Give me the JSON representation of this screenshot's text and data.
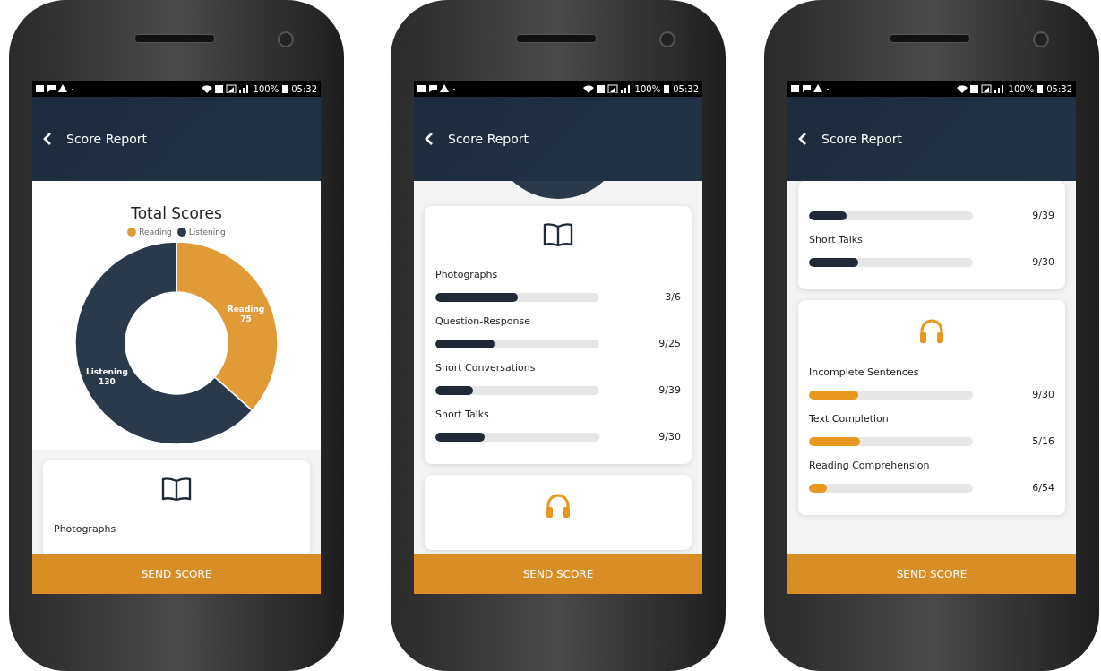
{
  "phones": [
    {
      "status_bar": {
        "battery": "100%",
        "time": "05:32"
      },
      "header": {
        "title": "Score Report"
      },
      "sections": [
        {
          "kind": "chart",
          "legend": [
            {
              "label": "Reading",
              "color": "#e09b36"
            },
            {
              "label": "Listening",
              "color": "#2b3a4b"
            }
          ],
          "chart_data": {
            "type": "donut",
            "title": "Total Scores",
            "categories": [
              "Reading",
              "Listening"
            ],
            "values": [
              75,
              130
            ],
            "data_labels": true
          }
        },
        {
          "kind": "reading_card",
          "items": [
            {
              "label": "Photographs"
            }
          ]
        }
      ],
      "button": "SEND SCORE"
    },
    {
      "status_bar": {
        "battery": "100%",
        "time": "05:32"
      },
      "header": {
        "title": "Score Report"
      },
      "sections": [
        {
          "kind": "chart_edge"
        },
        {
          "kind": "reading_card",
          "items": [
            {
              "label": "Photographs",
              "level": 0.5,
              "score": "3/6"
            },
            {
              "label": "Question-Response",
              "level": 0.36,
              "score": "9/25"
            },
            {
              "label": "Short Conversations",
              "level": 0.23,
              "score": "9/39"
            },
            {
              "label": "Short Talks",
              "level": 0.3,
              "score": "9/30"
            }
          ]
        },
        {
          "kind": "listening_card"
        }
      ],
      "button": "SEND SCORE"
    },
    {
      "status_bar": {
        "battery": "100%",
        "time": "05:32"
      },
      "header": {
        "title": "Score Report"
      },
      "sections": [
        {
          "kind": "card",
          "items": [
            {
              "level": 0.23,
              "score": "9/39"
            },
            {
              "label": "Short Talks",
              "level": 0.3,
              "score": "9/30"
            }
          ]
        },
        {
          "kind": "listening_card",
          "items": [
            {
              "label": "Incomplete Sentences",
              "level": 0.3,
              "score": "9/30"
            },
            {
              "label": "Text Completion",
              "level": 0.31,
              "score": "5/16"
            },
            {
              "label": "Reading Comprehension",
              "level": 0.11,
              "score": "6/54"
            }
          ]
        }
      ],
      "button": "SEND SCORE"
    }
  ]
}
